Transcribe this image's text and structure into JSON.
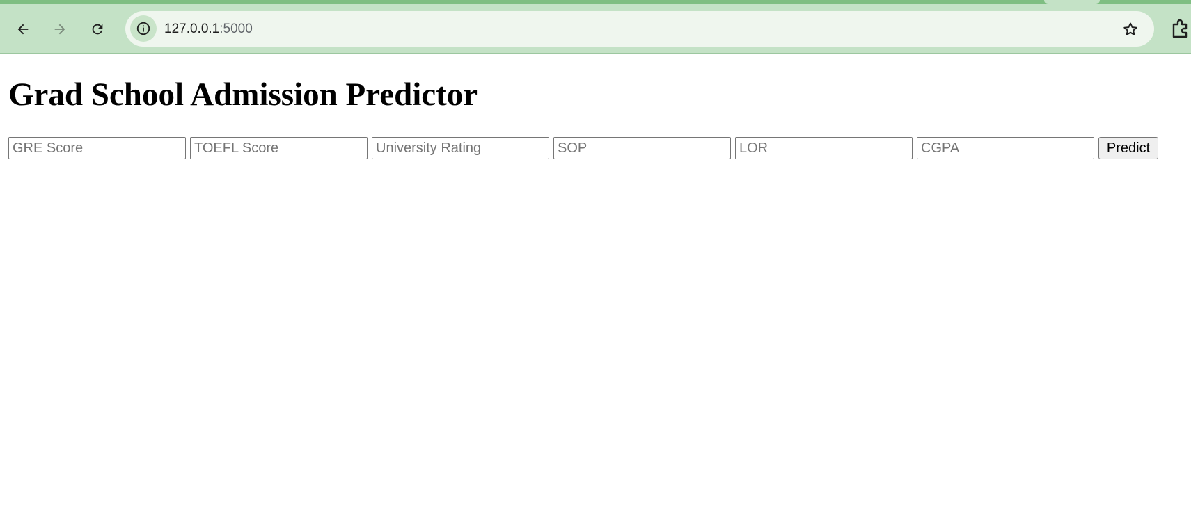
{
  "browser": {
    "url_host": "127.0.0.1",
    "url_port": ":5000",
    "accent_color": "#7fbe82",
    "toolbar_color": "#c4e2c6",
    "icons": {
      "back": "arrow-left-icon",
      "forward": "arrow-right-icon",
      "reload": "reload-icon",
      "site_info": "info-icon",
      "bookmark": "star-icon",
      "extensions": "puzzle-icon"
    }
  },
  "page": {
    "title": "Grad School Admission Predictor"
  },
  "form": {
    "fields": [
      {
        "placeholder": "GRE Score",
        "value": ""
      },
      {
        "placeholder": "TOEFL Score",
        "value": ""
      },
      {
        "placeholder": "University Rating",
        "value": ""
      },
      {
        "placeholder": "SOP",
        "value": ""
      },
      {
        "placeholder": "LOR",
        "value": ""
      },
      {
        "placeholder": "CGPA",
        "value": ""
      }
    ],
    "submit_label": "Predict"
  }
}
